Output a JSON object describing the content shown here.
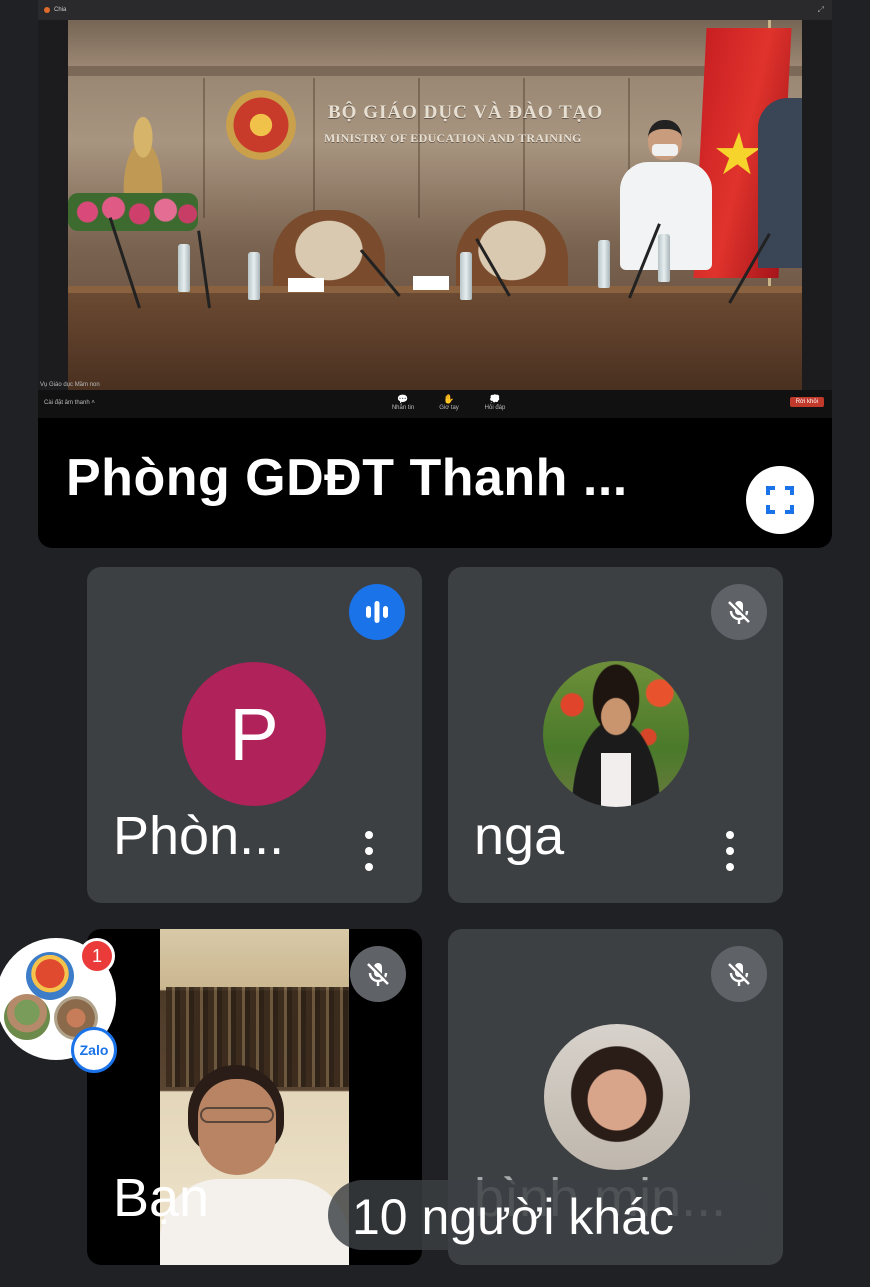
{
  "presentation": {
    "shared_window_title": "Chia",
    "sign_line1": "BỘ GIÁO DỤC VÀ ĐÀO TẠO",
    "sign_line2": "MINISTRY OF EDUCATION AND TRAINING",
    "shared_caption": "Vụ Giáo dục Mầm non",
    "toolbar": {
      "audio_settings": "Cài đặt âm thanh",
      "chat": "Nhắn tin",
      "raise_hand": "Giơ tay",
      "qa": "Hỏi đáp",
      "leave": "Rời khỏi"
    },
    "label": "Phòng GDĐT Thanh ...",
    "fullscreen_icon": "fullscreen-icon"
  },
  "participants": [
    {
      "name": "Phòn...",
      "avatar_letter": "P",
      "avatar_color": "#b0225a",
      "status": "speaking",
      "status_icon": "audio-level-icon"
    },
    {
      "name": "nga",
      "status": "muted",
      "status_icon": "mic-off-icon"
    },
    {
      "name": "Bạn",
      "status": "muted",
      "status_icon": "mic-off-icon"
    },
    {
      "name": "bình min...",
      "status": "muted",
      "status_icon": "mic-off-icon"
    }
  ],
  "others_count_label": "10 người khác",
  "zalo": {
    "badge_count": "1",
    "logo_text": "Zalo"
  },
  "colors": {
    "background": "#202124",
    "tile": "#3c4043",
    "speaking": "#1a73e8",
    "muted": "#5f6368"
  }
}
